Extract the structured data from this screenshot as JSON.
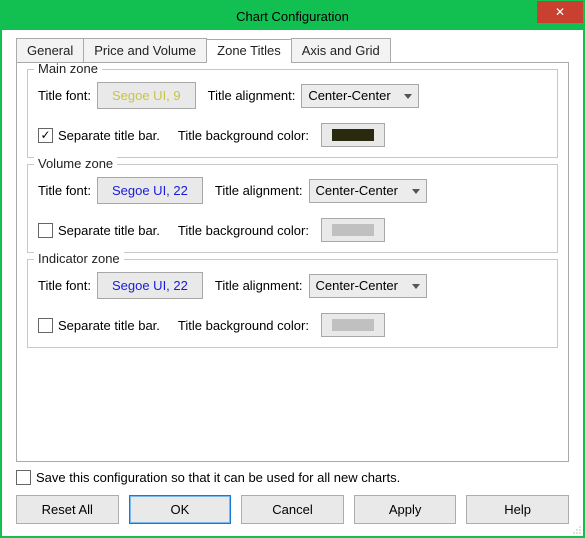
{
  "window": {
    "title": "Chart Configuration"
  },
  "tabs": {
    "general": "General",
    "price_volume": "Price and Volume",
    "zone_titles": "Zone Titles",
    "axis_grid": "Axis and Grid"
  },
  "labels": {
    "title_font": "Title font:",
    "title_alignment": "Title alignment:",
    "separate_title_bar": "Separate title bar.",
    "title_bg_color": "Title background color:"
  },
  "zones": {
    "main": {
      "legend": "Main zone",
      "font_label": "Segoe UI, 9",
      "alignment": "Center-Center",
      "separate_checked": true,
      "bg_color": "#2a2a0e"
    },
    "volume": {
      "legend": "Volume zone",
      "font_label": "Segoe UI, 22",
      "alignment": "Center-Center",
      "separate_checked": false,
      "bg_color": "#c0c0c0"
    },
    "indicator": {
      "legend": "Indicator zone",
      "font_label": "Segoe UI, 22",
      "alignment": "Center-Center",
      "separate_checked": false,
      "bg_color": "#c0c0c0"
    }
  },
  "footer": {
    "save_config": "Save this configuration so that it can be used for all new charts.",
    "reset_all": "Reset All",
    "ok": "OK",
    "cancel": "Cancel",
    "apply": "Apply",
    "help": "Help"
  }
}
